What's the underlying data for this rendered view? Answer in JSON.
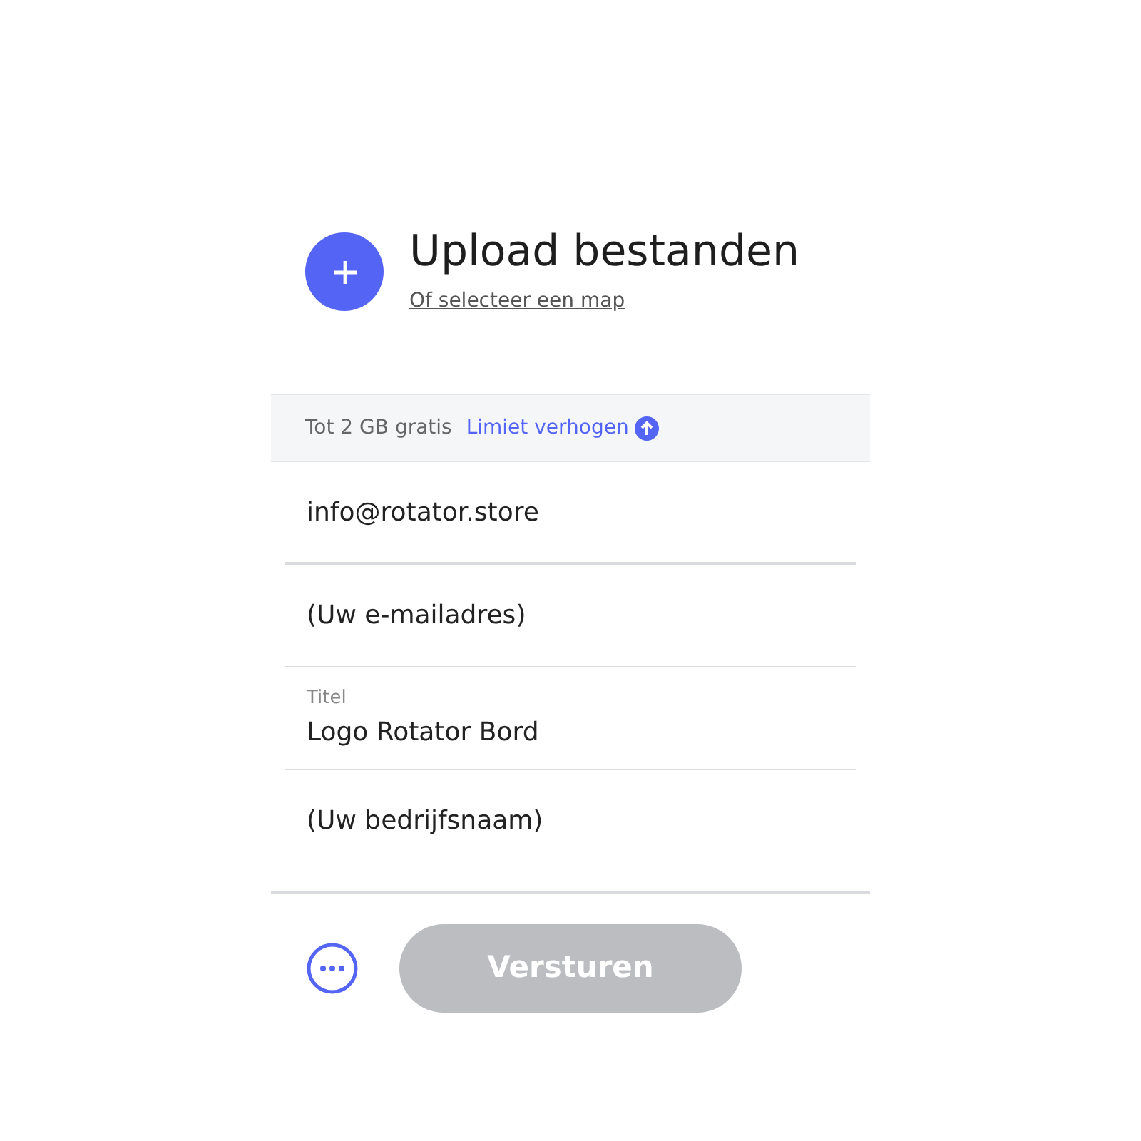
{
  "upload": {
    "title": "Upload bestanden",
    "folder_link": "Of selecteer een map"
  },
  "limit_bar": {
    "text": "Tot 2 GB gratis",
    "link": "Limiet verhogen"
  },
  "fields": [
    {
      "kind": "plain",
      "value": "info@rotator.store"
    },
    {
      "kind": "plain",
      "value": "(Uw e-mailadres)"
    },
    {
      "kind": "labeled",
      "label": "Titel",
      "value": "Logo Rotator Bord"
    },
    {
      "kind": "plain",
      "value": "(Uw bedrijfsnaam)"
    }
  ],
  "submit": {
    "label": "Versturen",
    "disabled": true
  }
}
